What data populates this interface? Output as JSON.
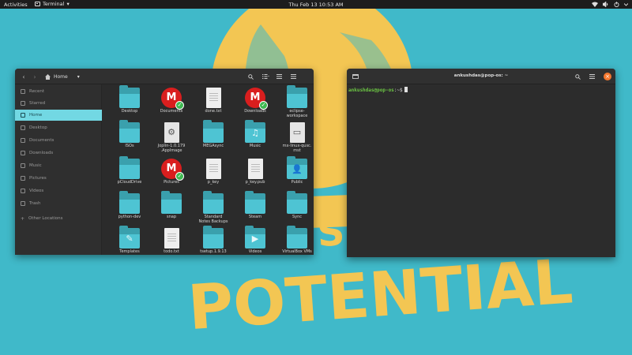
{
  "topbar": {
    "activities": "Activities",
    "app_name": "Terminal",
    "app_menu_arrow": "▾",
    "clock": "Thu Feb 13  10:53 AM"
  },
  "wallpaper": {
    "text_line1": "SH",
    "text_line2": "POTENTIAL"
  },
  "files": {
    "location": "Home",
    "location_arrow": "▾",
    "sidebar": [
      {
        "label": "Recent",
        "active": false
      },
      {
        "label": "Starred",
        "active": false
      },
      {
        "label": "Home",
        "active": true
      },
      {
        "label": "Desktop",
        "active": false
      },
      {
        "label": "Documents",
        "active": false
      },
      {
        "label": "Downloads",
        "active": false
      },
      {
        "label": "Music",
        "active": false
      },
      {
        "label": "Pictures",
        "active": false
      },
      {
        "label": "Videos",
        "active": false
      },
      {
        "label": "Trash",
        "active": false
      },
      {
        "label": "Other Locations",
        "active": false
      }
    ],
    "items": [
      {
        "label": "Desktop",
        "icon": "folder"
      },
      {
        "label": "Documents",
        "icon": "mega"
      },
      {
        "label": "done.txt",
        "icon": "doc"
      },
      {
        "label": "Downloads",
        "icon": "mega"
      },
      {
        "label": "eclipse-\nworkspace",
        "icon": "folder"
      },
      {
        "label": "ISOs",
        "icon": "folder"
      },
      {
        "label": "Joplin-1.0.179\n.AppImage",
        "icon": "gear"
      },
      {
        "label": "MEGAsync",
        "icon": "folder"
      },
      {
        "label": "Music",
        "icon": "music"
      },
      {
        "label": "mx-linux-qusc.\nmst",
        "icon": "img"
      },
      {
        "label": "pCloudDrive",
        "icon": "folder"
      },
      {
        "label": "Pictures",
        "icon": "mega"
      },
      {
        "label": "p_key",
        "icon": "doc"
      },
      {
        "label": "p_key.pub",
        "icon": "doc"
      },
      {
        "label": "Public",
        "icon": "user"
      },
      {
        "label": "python-dev",
        "icon": "folder"
      },
      {
        "label": "snap",
        "icon": "folder"
      },
      {
        "label": "Standard\nNotes Backups",
        "icon": "folder"
      },
      {
        "label": "Steam",
        "icon": "folder"
      },
      {
        "label": "Sync",
        "icon": "folder"
      },
      {
        "label": "Templates",
        "icon": "template"
      },
      {
        "label": "todo.txt",
        "icon": "doc"
      },
      {
        "label": "tsetup.1.9.13",
        "icon": "folder"
      },
      {
        "label": "Videos",
        "icon": "video"
      },
      {
        "label": "VirtualBox VMs",
        "icon": "folder"
      }
    ]
  },
  "terminal": {
    "title": "ankushdas@pop-os: ~",
    "prompt_user": "ankushdas@pop-os",
    "prompt_rest": ":~$",
    "close_glyph": "×"
  },
  "colors": {
    "wallpaper": "#40b9c9",
    "wallpaper_art": "#f3c653",
    "accent": "#72d8e3",
    "folder": "#4ec4d3",
    "mega": "#d91e1e",
    "terminal_prompt": "#6cc644",
    "close_button": "#f4772e"
  }
}
